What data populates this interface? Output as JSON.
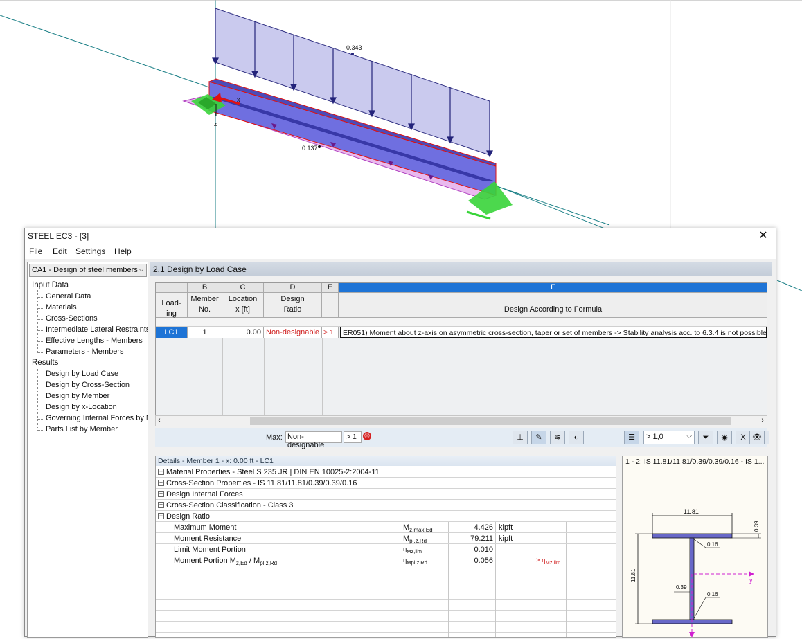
{
  "model": {
    "load_value_top": "0.343",
    "load_value_member": "0.137",
    "axis_x": "x",
    "axis_z": "z",
    "axis_y": "y"
  },
  "window": {
    "title": "STEEL EC3 - [3]",
    "close_glyph": "✕"
  },
  "menu": {
    "file": "File",
    "edit": "Edit",
    "settings": "Settings",
    "help": "Help"
  },
  "nav": {
    "case_select": "CA1 - Design of steel members",
    "input_group": "Input Data",
    "input_items": [
      "General Data",
      "Materials",
      "Cross-Sections",
      "Intermediate Lateral Restraints",
      "Effective Lengths - Members",
      "Parameters - Members"
    ],
    "results_group": "Results",
    "results_items": [
      "Design by Load Case",
      "Design by Cross-Section",
      "Design by Member",
      "Design by x-Location",
      "Governing Internal Forces by M",
      "Parts List by Member"
    ]
  },
  "section_header": "2.1 Design by Load Case",
  "table": {
    "col_letters": [
      "B",
      "C",
      "D",
      "E",
      "F"
    ],
    "headers": {
      "loading": [
        "Load-",
        "ing"
      ],
      "member": [
        "Member",
        "No."
      ],
      "location": [
        "Location",
        "x [ft]"
      ],
      "design": [
        "Design",
        "Ratio"
      ],
      "formula": "Design According to Formula"
    },
    "row": {
      "loading": "LC1",
      "member": "1",
      "location": "0.00",
      "ratio": "Non-designable",
      "flag": "> 1",
      "formula": "ER051) Moment about z-axis on asymmetric cross-section, taper or set of members -> Stability analysis acc. to 6.3.4 is not possible"
    }
  },
  "toolbar": {
    "max_label": "Max:",
    "max_value": "Non-designable",
    "max_flag": "> 1",
    "filter_value": "> 1,0"
  },
  "details": {
    "title": "Details - Member 1 - x: 0.00 ft - LC1",
    "material": "Material Properties - Steel S 235 JR | DIN EN 10025-2:2004-11",
    "cross_section": "Cross-Section Properties  -  IS 11.81/11.81/0.39/0.39/0.16",
    "internal_forces": "Design Internal Forces",
    "classification": "Cross-Section Classification - Class 3",
    "design_ratio": "Design Ratio",
    "rows": [
      {
        "label": "Maximum Moment",
        "symbol": "M",
        "symbol_sub": "z,max,Ed",
        "value": "4.426",
        "unit": "kipft",
        "note": ""
      },
      {
        "label": "Moment Resistance",
        "symbol": "M",
        "symbol_sub": "pl,z,Rd",
        "value": "79.211",
        "unit": "kipft",
        "note": ""
      },
      {
        "label": "Limit Moment Portion",
        "symbol": "η",
        "symbol_sub": "Mz,lim",
        "value": "0.010",
        "unit": "",
        "note": ""
      },
      {
        "label": "Moment Portion M",
        "label_sub1": "z,Ed",
        "label_mid": " / M",
        "label_sub2": "pl,z,Rd",
        "symbol": "η",
        "symbol_sub": "Mpl,z,Rd",
        "value": "0.056",
        "unit": "",
        "note": "> η",
        "note_sub": "Mz,lim"
      }
    ]
  },
  "section_figure": {
    "title": "1 - 2: IS 11.81/11.81/0.39/0.39/0.16 - IS 1...",
    "width_dim": "11.81",
    "flange_dim": "0.39",
    "height_dim": "11.81",
    "weld_top": "0.16",
    "web_dim": "0.39",
    "weld_bottom": "0.16"
  },
  "colors": {
    "beam": "#6f6fe0",
    "load": "#c8c8ee",
    "support": "#39d43a",
    "axis": "#1a7f86",
    "error_text": "#d02020"
  }
}
